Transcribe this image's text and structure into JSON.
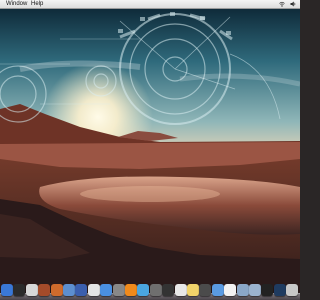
{
  "menubar": {
    "items": [
      "Window",
      "Help"
    ],
    "status_icons": [
      "wifi-icon",
      "volume-icon"
    ]
  },
  "desktop": {
    "wallpaper": "gear-overlay-sunset-lake"
  },
  "dock": {
    "apps": [
      {
        "name": "finder-icon",
        "color": "#3a78d6"
      },
      {
        "name": "dashboard-icon",
        "color": "#2b2b2b"
      },
      {
        "name": "mail-icon",
        "color": "#d8d8d8"
      },
      {
        "name": "address-book-icon",
        "color": "#a54b2a"
      },
      {
        "name": "photos-icon",
        "color": "#cf6b2c"
      },
      {
        "name": "preview-icon",
        "color": "#5d8fcf"
      },
      {
        "name": "itunes-icon",
        "color": "#3b5fae"
      },
      {
        "name": "app-store-icon",
        "color": "#e4e4e4"
      },
      {
        "name": "safari-icon",
        "color": "#4a90e2"
      },
      {
        "name": "system-preferences-icon",
        "color": "#888888"
      },
      {
        "name": "vlc-icon",
        "color": "#f08a1c"
      },
      {
        "name": "chat-icon",
        "color": "#4aa6e0"
      },
      {
        "name": "settings-icon",
        "color": "#6f6f6f"
      },
      {
        "name": "camera-icon",
        "color": "#333333"
      },
      {
        "name": "calendar-icon",
        "color": "#e8e8e8"
      },
      {
        "name": "notes-icon",
        "color": "#f1d36a"
      },
      {
        "name": "chess-icon",
        "color": "#4b4b4b"
      },
      {
        "name": "finder-face-icon",
        "color": "#5a9be2"
      },
      {
        "name": "text-edit-icon",
        "color": "#f2f2f2"
      },
      {
        "name": "folder-icon",
        "color": "#8aa7c8"
      },
      {
        "name": "documents-icon",
        "color": "#9bb3cf"
      },
      {
        "name": "terminal-icon",
        "color": "#222222"
      },
      {
        "name": "photoshop-icon",
        "color": "#1f3b60"
      },
      {
        "name": "trash-icon",
        "color": "#c8c8c8"
      }
    ]
  }
}
